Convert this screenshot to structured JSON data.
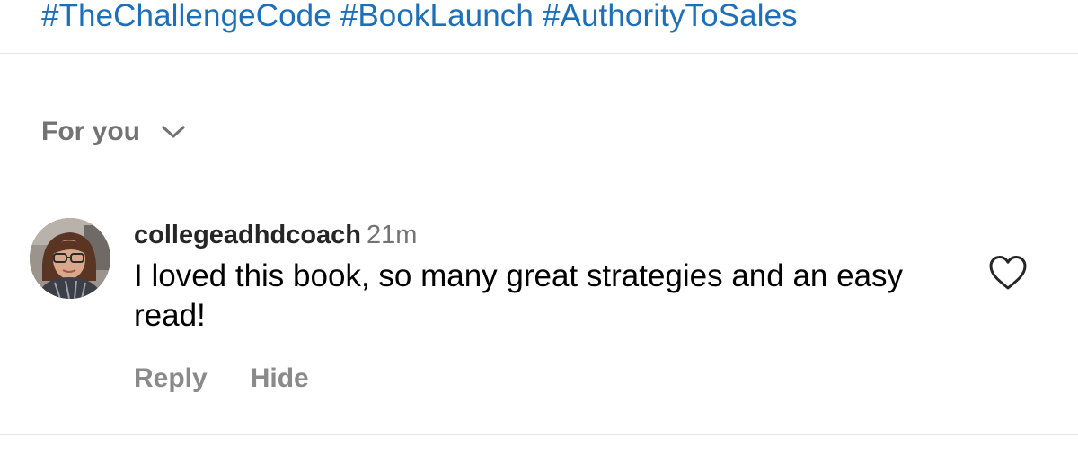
{
  "post": {
    "hashtags": [
      "#TheChallengeCode",
      "#BookLaunch",
      "#AuthorityToSales"
    ]
  },
  "comments_header": {
    "sort_label": "For you",
    "sort_icon": "chevron-down-icon"
  },
  "comment": {
    "username": "collegeadhdcoach",
    "time": "21m",
    "text": "I loved this book, so many great strategies and an easy read!",
    "reply_label": "Reply",
    "hide_label": "Hide",
    "like_icon": "heart-outline-icon"
  },
  "colors": {
    "hashtag": "#1e6fb8",
    "secondary_text": "#737373",
    "divider": "#e6e6e6"
  }
}
